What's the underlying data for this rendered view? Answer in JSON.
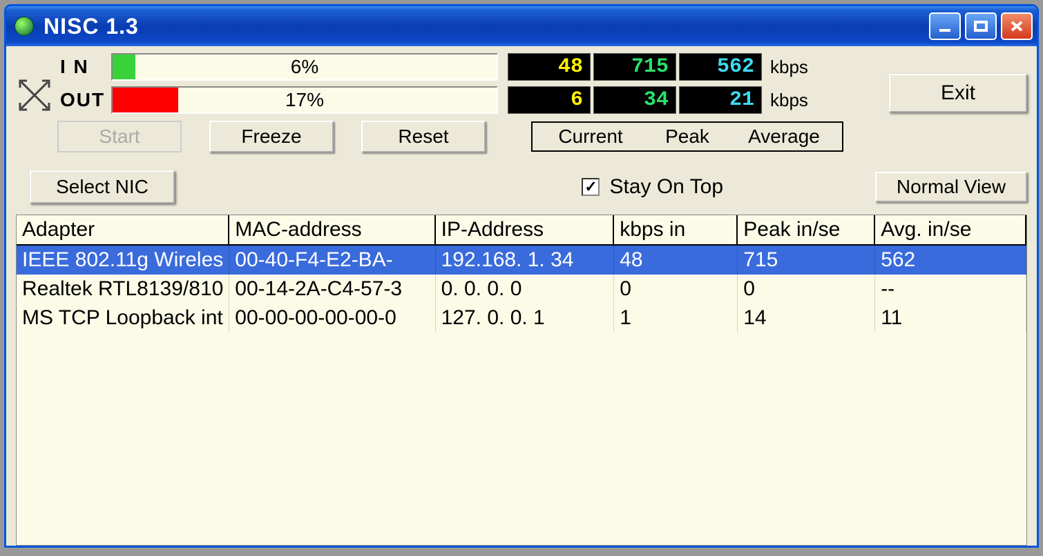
{
  "window": {
    "title": "NISC  1.3"
  },
  "meters": {
    "in": {
      "label": "I N",
      "percent": 6,
      "percent_text": "6%",
      "current": "48",
      "peak": "715",
      "average": "562",
      "unit": "kbps"
    },
    "out": {
      "label": "OUT",
      "percent": 17,
      "percent_text": "17%",
      "current": "6",
      "peak": "34",
      "average": "21",
      "unit": "kbps"
    }
  },
  "buttons": {
    "start": "Start",
    "freeze": "Freeze",
    "reset": "Reset",
    "exit": "Exit",
    "select_nic": "Select NIC",
    "normal_view": "Normal View"
  },
  "stat_labels": {
    "current": "Current",
    "peak": "Peak",
    "average": "Average"
  },
  "stay_on_top": {
    "label": "Stay On Top",
    "checked": true
  },
  "grid": {
    "headers": [
      "Adapter",
      "MAC-address",
      "IP-Address",
      "kbps in",
      "Peak in/se",
      "Avg. in/se"
    ],
    "rows": [
      {
        "selected": true,
        "cells": [
          "IEEE 802.11g Wireles",
          "00-40-F4-E2-BA-",
          "192.168.  1. 34",
          "48",
          "715",
          "562"
        ]
      },
      {
        "selected": false,
        "cells": [
          "Realtek RTL8139/810",
          "00-14-2A-C4-57-3",
          "  0.  0.  0.  0",
          "0",
          "0",
          "  --"
        ]
      },
      {
        "selected": false,
        "cells": [
          "MS TCP Loopback int",
          "00-00-00-00-00-0",
          "127.  0.  0.  1",
          "1",
          "14",
          "11"
        ]
      }
    ]
  }
}
